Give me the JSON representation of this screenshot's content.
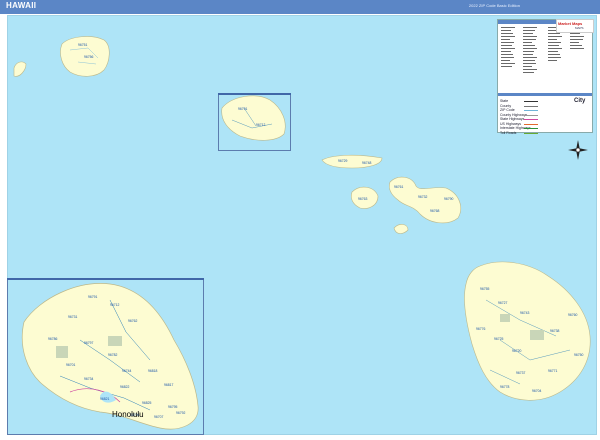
{
  "map": {
    "title": "HAWAII",
    "edition": "2022 ZIP Code Basic Edition",
    "colors": {
      "ocean": "#aee4f7",
      "land": "#fdfcd2",
      "zip_label": "#1a55a8",
      "roads": "#2a7fb8",
      "title_bar": "#5b86c6"
    },
    "compass": "compass-rose-icon",
    "inset_label": "Honolulu"
  },
  "zip_labels": {
    "kauai": [
      "96751",
      "96756"
    ],
    "oahu_small": [
      "96791",
      "96712"
    ],
    "molokai": [
      "96729",
      "96748"
    ],
    "lanai": [
      "96763"
    ],
    "maui": [
      "96761",
      "96732",
      "96768",
      "96790"
    ],
    "hawaii": [
      "96755",
      "96727",
      "96743",
      "96776",
      "96725",
      "96720",
      "96738",
      "96760",
      "96750",
      "96771",
      "96737",
      "96704",
      "96778"
    ],
    "oahu_inset": [
      "96791",
      "96712",
      "96731",
      "96762",
      "96786",
      "96797",
      "96782",
      "96701",
      "96744",
      "96734",
      "96818",
      "96817",
      "96822",
      "96821",
      "96825",
      "96795",
      "96707",
      "96706",
      "96792"
    ]
  },
  "legend": {
    "rows": [
      "State",
      "County",
      "ZIP Code",
      "County Highways",
      "State Highways",
      "US Highways",
      "Interstate Highways",
      "Toll Roads"
    ],
    "city_word": "City"
  },
  "logo": {
    "brand": "Market Maps",
    "tag": "MAPS"
  }
}
